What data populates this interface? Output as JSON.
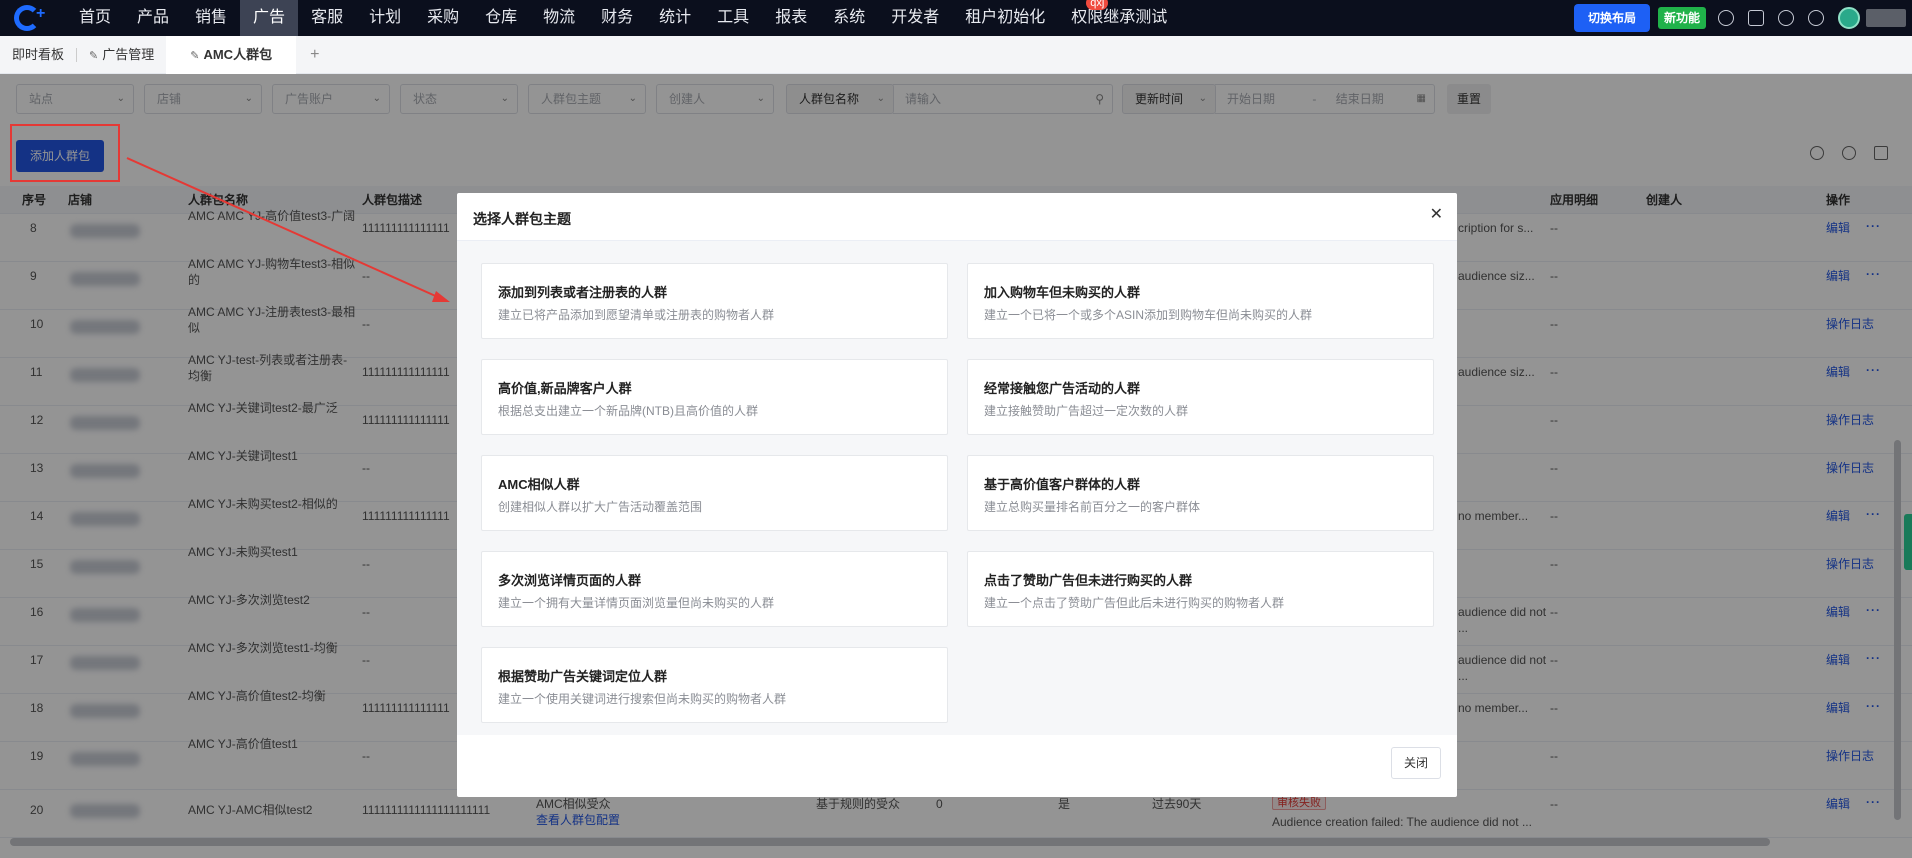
{
  "nav": {
    "items": [
      "首页",
      "产品",
      "销售",
      "广告",
      "客服",
      "计划",
      "采购",
      "仓库",
      "物流",
      "财务",
      "统计",
      "工具",
      "报表",
      "系统",
      "开发者",
      "租户初始化",
      "权限继承测试"
    ],
    "badge": "qxj",
    "switch_layout": "切换布局",
    "new_feature": "新功能"
  },
  "tabs": {
    "items": [
      "即时看板",
      "广告管理",
      "AMC人群包"
    ]
  },
  "filters": {
    "site": "站点",
    "shop": "店铺",
    "ad_account": "广告账户",
    "status": "状态",
    "theme": "人群包主题",
    "creator": "创建人",
    "name_field": "人群包名称",
    "search_placeholder": "请输入",
    "time_field": "更新时间",
    "start_date": "开始日期",
    "sep": "-",
    "end_date": "结束日期",
    "reset": "重置"
  },
  "add_button": "添加人群包",
  "table": {
    "headers": {
      "index": "序号",
      "shop": "店铺",
      "name": "人群包名称",
      "desc": "人群包描述",
      "apply": "应用明细",
      "creator": "创建人",
      "actions": "操作"
    },
    "edit": "编辑",
    "log": "操作日志",
    "more": "···",
    "view_config": "查看人群包配置",
    "fail_tag": "审核失败",
    "rows": [
      {
        "idx": "8",
        "name": "AMC AMC YJ-高价值test3-广阔",
        "desc": "111111111111111",
        "extra": "cription for s...",
        "apply": "--",
        "act": "编辑"
      },
      {
        "idx": "9",
        "name": "AMC AMC YJ-购物车test3-相似的",
        "desc": "--",
        "extra": "audience siz...",
        "apply": "--",
        "act": "编辑"
      },
      {
        "idx": "10",
        "name": "AMC AMC YJ-注册表test3-最相似",
        "desc": "--",
        "extra": "",
        "apply": "--",
        "act": "操作日志"
      },
      {
        "idx": "11",
        "name": "AMC YJ-test-列表或者注册表-均衡",
        "desc": "111111111111111",
        "extra": "audience siz...",
        "apply": "--",
        "act": "编辑"
      },
      {
        "idx": "12",
        "name": "AMC YJ-关键词test2-最广泛",
        "desc": "111111111111111",
        "extra": "",
        "apply": "--",
        "act": "操作日志"
      },
      {
        "idx": "13",
        "name": "AMC YJ-关键词test1",
        "desc": "--",
        "extra": "",
        "apply": "--",
        "act": "操作日志"
      },
      {
        "idx": "14",
        "name": "AMC YJ-未购买test2-相似的",
        "desc": "111111111111111",
        "extra": "no member...",
        "apply": "--",
        "act": "编辑"
      },
      {
        "idx": "15",
        "name": "AMC YJ-未购买test1",
        "desc": "--",
        "extra": "",
        "apply": "--",
        "act": "操作日志"
      },
      {
        "idx": "16",
        "name": "AMC YJ-多次浏览test2",
        "desc": "--",
        "extra": "audience did not ...",
        "apply": "--",
        "act": "编辑"
      },
      {
        "idx": "17",
        "name": "AMC YJ-多次浏览test1-均衡",
        "desc": "--",
        "extra": "audience did not ...",
        "apply": "--",
        "act": "编辑"
      },
      {
        "idx": "18",
        "name": "AMC YJ-高价值test2-均衡",
        "desc": "111111111111111",
        "extra": "no member...",
        "apply": "--",
        "act": "编辑"
      },
      {
        "idx": "19",
        "name": "AMC YJ-高价值test1",
        "desc": "--",
        "extra": "",
        "apply": "--",
        "act": "操作日志"
      }
    ],
    "last_row": {
      "idx": "20",
      "name": "AMC YJ-AMC相似test2",
      "desc": "1111111111111111111111",
      "audience": "AMC相似受众",
      "rule": "基于规则的受众",
      "zero": "0",
      "yes": "是",
      "days": "过去90天",
      "fail_msg": "Audience creation failed: The audience did not ...",
      "apply": "--"
    }
  },
  "modal": {
    "title": "选择人群包主题",
    "close_btn": "关闭",
    "cards": [
      {
        "title": "添加到列表或者注册表的人群",
        "desc": "建立已将产品添加到愿望清单或注册表的购物者人群"
      },
      {
        "title": "加入购物车但未购买的人群",
        "desc": "建立一个已将一个或多个ASIN添加到购物车但尚未购买的人群"
      },
      {
        "title": "高价值,新品牌客户人群",
        "desc": "根据总支出建立一个新品牌(NTB)且高价值的人群"
      },
      {
        "title": "经常接触您广告活动的人群",
        "desc": "建立接触赞助广告超过一定次数的人群"
      },
      {
        "title": "AMC相似人群",
        "desc": "创建相似人群以扩大广告活动覆盖范围"
      },
      {
        "title": "基于高价值客户群体的人群",
        "desc": "建立总购买量排名前百分之一的客户群体"
      },
      {
        "title": "多次浏览详情页面的人群",
        "desc": "建立一个拥有大量详情页面浏览量但尚未购买的人群"
      },
      {
        "title": "点击了赞助广告但未进行购买的人群",
        "desc": "建立一个点击了赞助广告但此后未进行购买的购物者人群"
      },
      {
        "title": "根据赞助广告关键词定位人群",
        "desc": "建立一个使用关键词进行搜索但尚未购买的购物者人群"
      }
    ]
  },
  "colors": {
    "primary": "#2357e6",
    "nav_bg": "#0b0f1d",
    "highlight": "#e53935",
    "green": "#20b24a"
  }
}
